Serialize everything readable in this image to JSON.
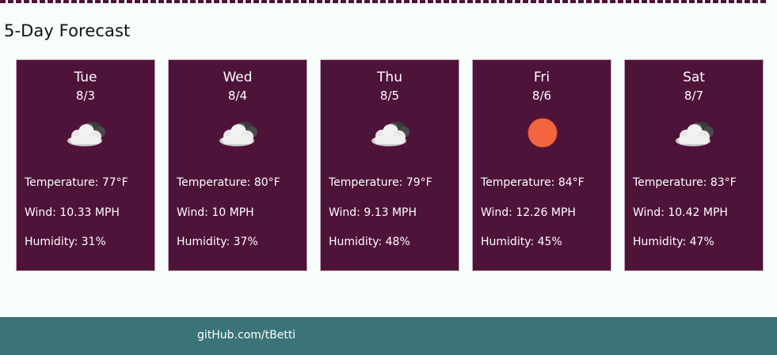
{
  "heading": "5-Day Forecast",
  "labels": {
    "temperature": "Temperature: ",
    "wind": "Wind: ",
    "humidity": "Humidity: "
  },
  "colors": {
    "background": "#f6fdfa",
    "card": "#4e1339",
    "card_border": "#c6a6b8",
    "footer": "#3a7479",
    "sun": "#f26540"
  },
  "forecast": [
    {
      "day": "Tue",
      "date": "8/3",
      "icon": "cloudy-icon",
      "temperature": "77°F",
      "wind": "10.33 MPH",
      "humidity": "31%"
    },
    {
      "day": "Wed",
      "date": "8/4",
      "icon": "cloudy-icon",
      "temperature": "80°F",
      "wind": "10 MPH",
      "humidity": "37%"
    },
    {
      "day": "Thu",
      "date": "8/5",
      "icon": "cloudy-icon",
      "temperature": "79°F",
      "wind": "9.13 MPH",
      "humidity": "48%"
    },
    {
      "day": "Fri",
      "date": "8/6",
      "icon": "sun-icon",
      "temperature": "84°F",
      "wind": "12.26 MPH",
      "humidity": "45%"
    },
    {
      "day": "Sat",
      "date": "8/7",
      "icon": "cloudy-icon",
      "temperature": "83°F",
      "wind": "10.42 MPH",
      "humidity": "47%"
    }
  ],
  "footer": {
    "link_text": "gitHub.com/tBetti"
  }
}
